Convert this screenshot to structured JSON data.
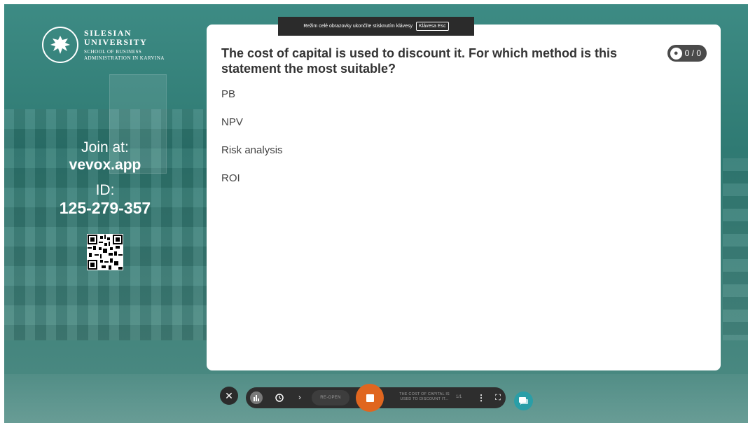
{
  "logo": {
    "line1": "SILESIAN",
    "line2": "UNIVERSITY",
    "line3": "SCHOOL OF BUSINESS",
    "line4": "ADMINISTRATION IN KARVINA"
  },
  "join": {
    "label": "Join at:",
    "url": "vevox.app",
    "id_label": "ID:",
    "id_value": "125-279-357"
  },
  "fullscreen_notice": {
    "text": "Režim celé obrazovky ukončíte stisknutím klávesy",
    "key": "Klávesa Esc"
  },
  "question": {
    "text": "The cost of capital is used to discount it. For which method is this statement the most suitable?",
    "counter": "0 / 0",
    "options": [
      "PB",
      "NPV",
      "Risk analysis",
      "ROI"
    ]
  },
  "toolbar": {
    "reopen_label": "RE-OPEN",
    "title_line1": "THE COST OF CAPITAL IS",
    "title_line2": "USED TO DISCOUNT IT...",
    "page": "1/1"
  },
  "icons": {
    "close": "close-icon",
    "chart": "bar-chart-icon",
    "timer": "clock-icon",
    "next": "chevron-right-icon",
    "stop": "stop-icon",
    "more": "more-vertical-icon",
    "fullscreen": "fullscreen-icon",
    "messages": "message-icon",
    "participants": "people-icon"
  },
  "colors": {
    "background": "#3d8b84",
    "stop_button": "#e0661f",
    "message_button": "#2a9ea7",
    "toolbar": "#2e2e2e"
  }
}
